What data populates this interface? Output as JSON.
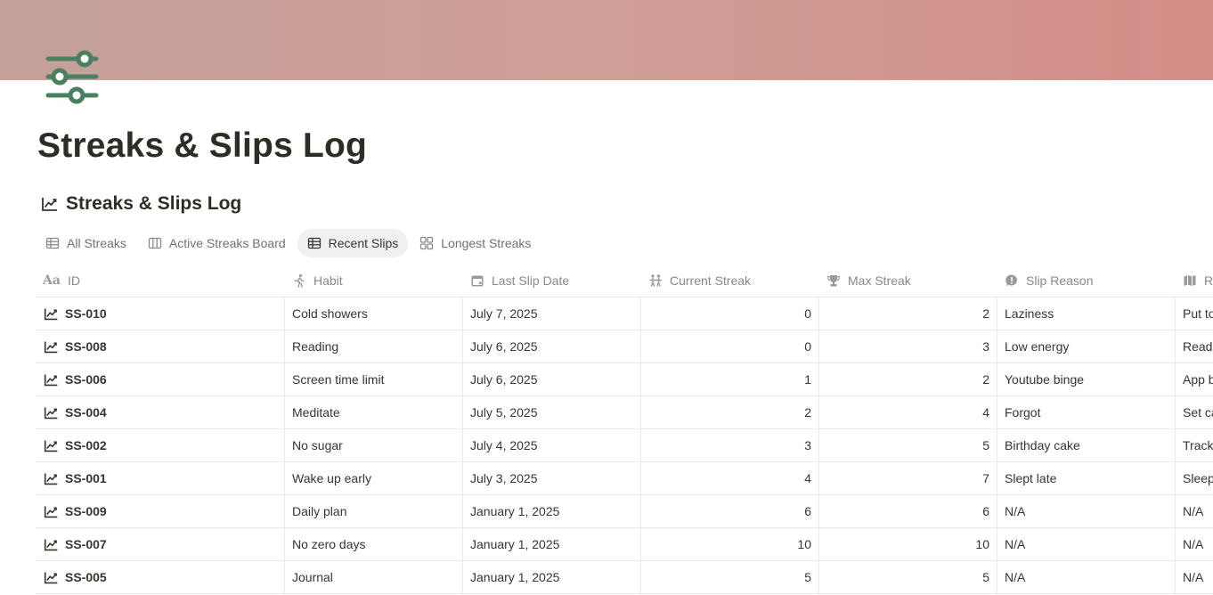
{
  "page": {
    "title": "Streaks & Slips Log",
    "icon": "sliders-icon",
    "cover_colors": [
      "#c5a09a",
      "#d48e88"
    ],
    "icon_color": "#4a8060"
  },
  "database": {
    "title": "Streaks & Slips Log",
    "icon": "trend-line-icon"
  },
  "tabs": [
    {
      "label": "All Streaks",
      "icon": "table-icon",
      "active": false
    },
    {
      "label": "Active Streaks Board",
      "icon": "board-icon",
      "active": false
    },
    {
      "label": "Recent Slips",
      "icon": "table-icon",
      "active": true
    },
    {
      "label": "Longest Streaks",
      "icon": "gallery-icon",
      "active": false
    }
  ],
  "columns": {
    "id": "ID",
    "habit": "Habit",
    "last_slip_date": "Last Slip Date",
    "current_streak": "Current Streak",
    "max_streak": "Max Streak",
    "slip_reason": "Slip Reason",
    "remedy": "R"
  },
  "rows": [
    {
      "id": "SS-010",
      "habit": "Cold showers",
      "date": "July 7, 2025",
      "current": "0",
      "max": "2",
      "reason": "Laziness",
      "remedy": "Put to"
    },
    {
      "id": "SS-008",
      "habit": "Reading",
      "date": "July 6, 2025",
      "current": "0",
      "max": "3",
      "reason": "Low energy",
      "remedy": "Read"
    },
    {
      "id": "SS-006",
      "habit": "Screen time limit",
      "date": "July 6, 2025",
      "current": "1",
      "max": "2",
      "reason": "Youtube binge",
      "remedy": "App b"
    },
    {
      "id": "SS-004",
      "habit": "Meditate",
      "date": "July 5, 2025",
      "current": "2",
      "max": "4",
      "reason": "Forgot",
      "remedy": "Set ca"
    },
    {
      "id": "SS-002",
      "habit": "No sugar",
      "date": "July 4, 2025",
      "current": "3",
      "max": "5",
      "reason": "Birthday cake",
      "remedy": "Track"
    },
    {
      "id": "SS-001",
      "habit": "Wake up early",
      "date": "July 3, 2025",
      "current": "4",
      "max": "7",
      "reason": "Slept late",
      "remedy": "Sleep"
    },
    {
      "id": "SS-009",
      "habit": "Daily plan",
      "date": "January 1, 2025",
      "current": "6",
      "max": "6",
      "reason": "N/A",
      "remedy": "N/A"
    },
    {
      "id": "SS-007",
      "habit": "No zero days",
      "date": "January 1, 2025",
      "current": "10",
      "max": "10",
      "reason": "N/A",
      "remedy": "N/A"
    },
    {
      "id": "SS-005",
      "habit": "Journal",
      "date": "January 1, 2025",
      "current": "5",
      "max": "5",
      "reason": "N/A",
      "remedy": "N/A"
    }
  ]
}
